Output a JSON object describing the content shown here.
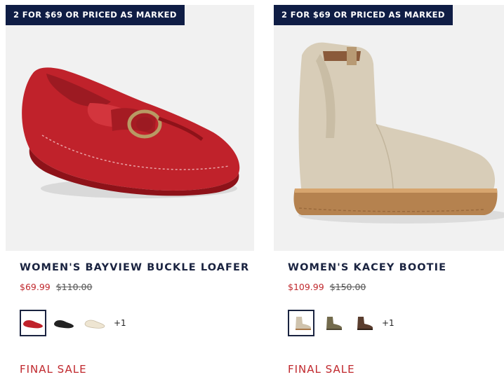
{
  "products": [
    {
      "promo": "2 FOR $69 OR PRICED AS MARKED",
      "title": "WOMEN'S BAYVIEW BUCKLE LOAFER",
      "sale_price": "$69.99",
      "original_price": "$110.00",
      "swatches": [
        {
          "name": "red-loafer-swatch",
          "color": "#c0222b"
        },
        {
          "name": "black-loafer-swatch",
          "color": "#222222"
        },
        {
          "name": "cream-loafer-swatch",
          "color": "#eee5d2"
        }
      ],
      "more_colors": "+1",
      "badge": "FINAL SALE"
    },
    {
      "promo": "2 FOR $69 OR PRICED AS MARKED",
      "title": "WOMEN'S KACEY BOOTIE",
      "sale_price": "$109.99",
      "original_price": "$150.00",
      "swatches": [
        {
          "name": "taupe-bootie-swatch",
          "color": "#cfc3ad"
        },
        {
          "name": "olive-bootie-swatch",
          "color": "#736b4d"
        },
        {
          "name": "brown-bootie-swatch",
          "color": "#5a3d2e"
        }
      ],
      "more_colors": "+1",
      "badge": "FINAL SALE"
    }
  ],
  "colors": {
    "promo_bg": "#0f1d45",
    "title": "#1a2340",
    "sale": "#c0282d"
  }
}
